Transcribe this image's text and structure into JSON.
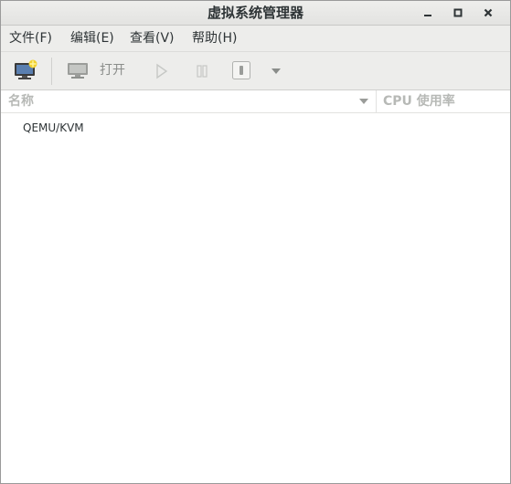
{
  "window": {
    "title": "虚拟系统管理器",
    "controls": [
      "minimize-icon",
      "maximize-icon",
      "close-icon"
    ]
  },
  "menubar": {
    "items": [
      {
        "label": "文件(F)"
      },
      {
        "label": "编辑(E)"
      },
      {
        "label": "查看(V)"
      },
      {
        "label": "帮助(H)"
      }
    ]
  },
  "toolbar": {
    "new_icon": "new-vm-monitor-icon",
    "open_icon": "monitor-icon",
    "open_label": "打开",
    "run_icon": "play-icon",
    "pause_icon": "pause-icon",
    "shutdown_icon": "power-icon",
    "menu_icon": "dropdown-arrow-icon"
  },
  "columns": {
    "name": "名称",
    "cpu": "CPU 使用率"
  },
  "connections": [
    {
      "label": "QEMU/KVM"
    }
  ]
}
